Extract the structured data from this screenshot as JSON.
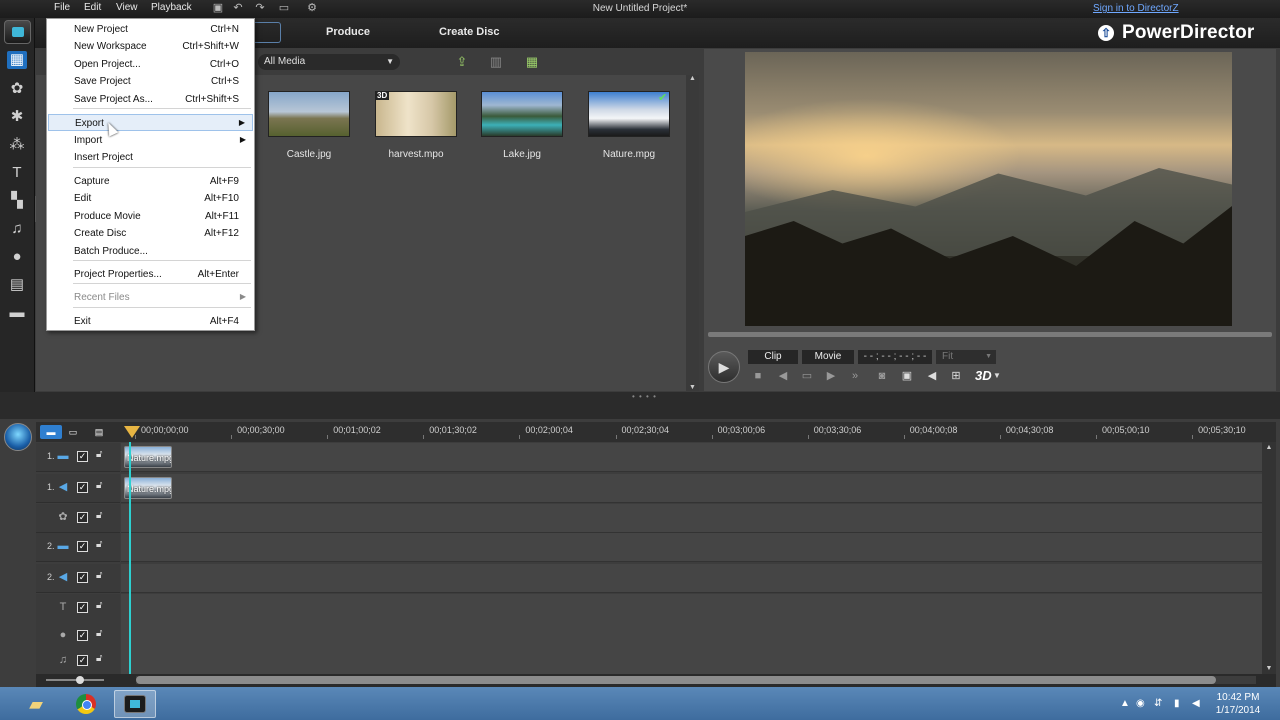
{
  "window": {
    "title": "New Untitled Project*",
    "sign_in": "Sign in to DirectorZ"
  },
  "menubar": {
    "items": [
      "File",
      "Edit",
      "View",
      "Playback"
    ]
  },
  "tabs": {
    "produce": "Produce",
    "create_disc": "Create Disc"
  },
  "brand": {
    "logo_glyph": "⇧",
    "name": "PowerDirector"
  },
  "file_menu": {
    "items": [
      {
        "label": "New Project",
        "shortcut": "Ctrl+N"
      },
      {
        "label": "New Workspace",
        "shortcut": "Ctrl+Shift+W"
      },
      {
        "label": "Open Project...",
        "shortcut": "Ctrl+O"
      },
      {
        "label": "Save Project",
        "shortcut": "Ctrl+S"
      },
      {
        "label": "Save Project As...",
        "shortcut": "Ctrl+Shift+S"
      },
      {
        "label": "Export",
        "shortcut": "",
        "submenu": true,
        "highlighted": true
      },
      {
        "label": "Import",
        "shortcut": "",
        "submenu": true
      },
      {
        "label": "Insert Project",
        "shortcut": ""
      },
      {
        "label": "Capture",
        "shortcut": "Alt+F9"
      },
      {
        "label": "Edit",
        "shortcut": "Alt+F10"
      },
      {
        "label": "Produce Movie",
        "shortcut": "Alt+F11"
      },
      {
        "label": "Create Disc",
        "shortcut": "Alt+F12"
      },
      {
        "label": "Batch Produce...",
        "shortcut": ""
      },
      {
        "label": "Project Properties...",
        "shortcut": "Alt+Enter"
      },
      {
        "label": "Recent Files",
        "shortcut": "",
        "submenu": true,
        "disabled": true
      },
      {
        "label": "Exit",
        "shortcut": "Alt+F4"
      }
    ]
  },
  "library": {
    "filter": "All Media",
    "badge_3d": "3D",
    "media": [
      {
        "name": "Castle.jpg"
      },
      {
        "name": "harvest.mpo"
      },
      {
        "name": "Lake.jpg"
      },
      {
        "name": "Nature.mpg"
      }
    ]
  },
  "preview": {
    "clip_label": "Clip",
    "movie_label": "Movie",
    "timecode": "- - ; - - ; - - ; - -",
    "fit_label": "Fit",
    "threed_label": "3D"
  },
  "timeline": {
    "ruler": [
      "00;00;00;00",
      "00;00;30;00",
      "00;01;00;02",
      "00;01;30;02",
      "00;02;00;04",
      "00;02;30;04",
      "00;03;00;06",
      "00;03;30;06",
      "00;04;00;08",
      "00;04;30;08",
      "00;05;00;10",
      "00;05;30;10"
    ],
    "tracks": [
      {
        "num": "1.",
        "type": "video",
        "icon": "▬",
        "clip": "Nature.mpg"
      },
      {
        "num": "1.",
        "type": "audio",
        "icon": "◀",
        "clip": "Nature.mpg"
      },
      {
        "num": "",
        "type": "effect",
        "icon": "✿",
        "clip": ""
      },
      {
        "num": "2.",
        "type": "video",
        "icon": "▬",
        "clip": ""
      },
      {
        "num": "2.",
        "type": "audio",
        "icon": "◀",
        "clip": ""
      },
      {
        "num": "",
        "type": "title",
        "icon": "T",
        "clip": ""
      },
      {
        "num": "",
        "type": "voice",
        "icon": "●",
        "clip": ""
      },
      {
        "num": "",
        "type": "music",
        "icon": "♫",
        "clip": ""
      }
    ]
  },
  "taskbar": {
    "time": "10:42 PM",
    "date": "1/17/2014"
  },
  "colors": {
    "accent": "#1f6fbf",
    "playhead": "#2dd0d0",
    "menu_highlight": "#e5eef9"
  }
}
